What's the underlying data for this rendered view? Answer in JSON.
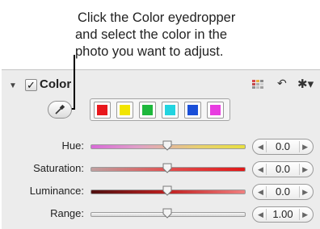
{
  "callout": {
    "lines": [
      "Click the Color eyedropper",
      "and select the color in the",
      "photo you want to adjust."
    ]
  },
  "panel": {
    "title": "Color",
    "enabled": true,
    "icons": [
      "disclosure-triangle-icon",
      "checkbox",
      "color-grid-icon",
      "undo-icon",
      "gear-icon"
    ],
    "swatches": [
      {
        "name": "red",
        "color": "#e8171c"
      },
      {
        "name": "yellow",
        "color": "#f2e500"
      },
      {
        "name": "green",
        "color": "#1eb83c"
      },
      {
        "name": "cyan",
        "color": "#22d4e0"
      },
      {
        "name": "blue",
        "color": "#1a4fd8"
      },
      {
        "name": "magenta",
        "color": "#e83ce0"
      }
    ],
    "rows": [
      {
        "label": "Hue:",
        "value": "0.0"
      },
      {
        "label": "Saturation:",
        "value": "0.0"
      },
      {
        "label": "Luminance:",
        "value": "0.0"
      },
      {
        "label": "Range:",
        "value": "1.00"
      }
    ]
  }
}
